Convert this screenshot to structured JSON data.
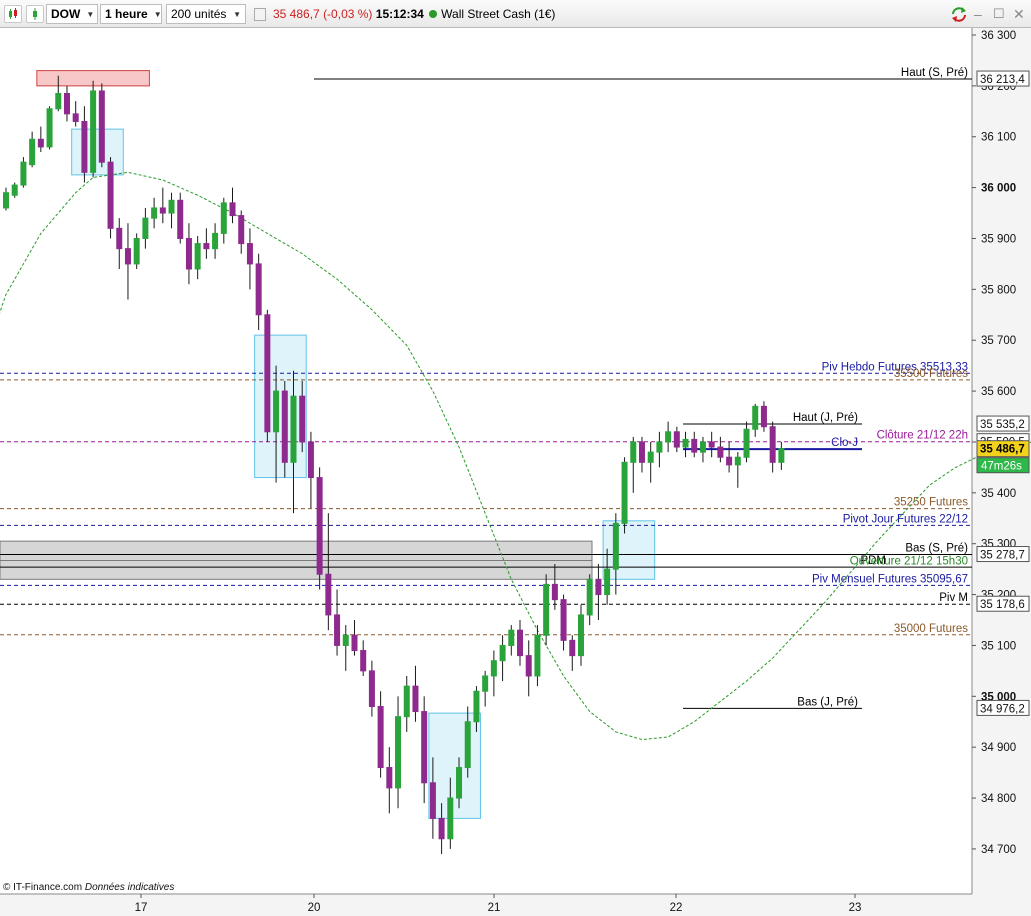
{
  "toolbar": {
    "symbol": "DOW",
    "timeframe": "1 heure",
    "units": "200 unités",
    "price": "35 486,7",
    "change": "(-0,03 %)",
    "time": "15:12:34",
    "instrument": "Wall Street Cash (1€)"
  },
  "colors": {
    "up": "#2aa43a",
    "down": "#8e2a8e",
    "sma": "#2a9a2a",
    "pivot_hebdo": "#1a1aa0",
    "pivot_mensuel": "#1a1aa0",
    "futures": "#8a5a2a",
    "cloture": "#9a1a9a"
  },
  "footer": {
    "source": "© IT-Finance.com",
    "note": "Données indicatives"
  },
  "chart_data": {
    "type": "candlestick",
    "yaxis": {
      "ticks": [
        "36 300",
        "36 200",
        "36 100",
        "36 000",
        "35 900",
        "35 800",
        "35 700",
        "35 600",
        "35 500",
        "35 400",
        "35 300",
        "35 200",
        "35 100",
        "35 000",
        "34 900",
        "34 800",
        "34 700"
      ],
      "tick_values": [
        36300,
        36200,
        36100,
        36000,
        35900,
        35800,
        35700,
        35600,
        35500,
        35400,
        35300,
        35200,
        35100,
        35000,
        34900,
        34800,
        34700
      ],
      "bold_ticks": [
        "36 000",
        "35 000"
      ],
      "range": [
        34630,
        36325
      ]
    },
    "xaxis": {
      "labels": [
        "17",
        "20",
        "21",
        "22",
        "23"
      ]
    },
    "current_price": {
      "label": "35 486,7",
      "value": 35486.7,
      "countdown": "47m26s"
    },
    "levels": [
      {
        "label": "Haut (S, Pré)",
        "value": 36213.4,
        "tag": "36 213,4",
        "style": "solid",
        "color": "#000000",
        "start": "mid"
      },
      {
        "label": "Piv Hebdo Futures 35513,33",
        "value": 35635,
        "tag": "",
        "style": "dashed",
        "color": "#1a1aa0",
        "start": "all"
      },
      {
        "label": "35500 Futures",
        "value": 35622,
        "tag": "",
        "style": "dashed",
        "color": "#8a5a2a",
        "start": "all"
      },
      {
        "label": "Haut (J, Pré)",
        "value": 35535.2,
        "tag": "35 535,2",
        "style": "solid",
        "color": "#000000",
        "start": "late"
      },
      {
        "label": "Clôture 21/12 22h",
        "value": 35500.5,
        "tag": "35 500,5",
        "style": "dashed",
        "color": "#9a1a9a",
        "start": "all"
      },
      {
        "label": "Clo-J",
        "value": 35486,
        "tag": "",
        "style": "solid",
        "color": "#1a1aa0",
        "start": "late"
      },
      {
        "label": "35250 Futures",
        "value": 35369,
        "tag": "",
        "style": "dashed",
        "color": "#8a5a2a",
        "start": "all"
      },
      {
        "label": "Pivot Jour Futures 22/12",
        "value": 35336,
        "tag": "",
        "style": "dashed",
        "color": "#1a1aa0",
        "start": "all"
      },
      {
        "label": "Bas (S, Pré)",
        "value": 35278.7,
        "tag": "35 278,7",
        "style": "solid",
        "color": "#000000",
        "start": "all"
      },
      {
        "label": "PDM",
        "value": 35254,
        "tag": "",
        "style": "solid",
        "color": "#000000",
        "start": "all"
      },
      {
        "label": "Ouverture 21/12 15h30",
        "value": 35253,
        "tag": "",
        "style": "solid",
        "color": "#2a8a2a",
        "start": "none"
      },
      {
        "label": "Piv Mensuel Futures 35095,67",
        "value": 35218,
        "tag": "",
        "style": "dashed",
        "color": "#1a1aa0",
        "start": "all"
      },
      {
        "label": "Piv M",
        "value": 35181,
        "tag": "35 178,6",
        "style": "dashed",
        "color": "#000000",
        "start": "all"
      },
      {
        "label": "35000 Futures",
        "value": 35121,
        "tag": "",
        "style": "dashed",
        "color": "#8a5a2a",
        "start": "all"
      },
      {
        "label": "Bas (J, Pré)",
        "value": 34976.2,
        "tag": "34 976,2",
        "style": "solid",
        "color": "#000000",
        "start": "late"
      }
    ],
    "sma": [
      [
        -1,
        35740
      ],
      [
        0,
        35790
      ],
      [
        4,
        35910
      ],
      [
        8,
        35990
      ],
      [
        10,
        36020
      ],
      [
        14,
        36030
      ],
      [
        18,
        36015
      ],
      [
        22,
        35985
      ],
      [
        26,
        35950
      ],
      [
        30,
        35910
      ],
      [
        34,
        35870
      ],
      [
        38,
        35820
      ],
      [
        42,
        35760
      ],
      [
        46,
        35690
      ],
      [
        49,
        35600
      ],
      [
        52,
        35490
      ],
      [
        55,
        35360
      ],
      [
        58,
        35230
      ],
      [
        61,
        35130
      ],
      [
        64,
        35040
      ],
      [
        67,
        34970
      ],
      [
        70,
        34930
      ],
      [
        73,
        34915
      ],
      [
        76,
        34920
      ],
      [
        79,
        34950
      ],
      [
        82,
        34990
      ],
      [
        85,
        35030
      ],
      [
        88,
        35075
      ],
      [
        91,
        35130
      ],
      [
        94,
        35185
      ],
      [
        97,
        35245
      ],
      [
        100,
        35305
      ],
      [
        103,
        35360
      ],
      [
        106,
        35415
      ],
      [
        109,
        35450
      ],
      [
        112,
        35475
      ],
      [
        114,
        35490
      ],
      [
        116,
        35496
      ],
      [
        118,
        35500
      ],
      [
        120,
        35504
      ],
      [
        122,
        35507
      ],
      [
        125,
        35509
      ]
    ],
    "candles": [
      [
        35960,
        36000,
        35955,
        35990
      ],
      [
        35985,
        36010,
        35980,
        36005
      ],
      [
        36005,
        36060,
        36000,
        36050
      ],
      [
        36045,
        36110,
        36040,
        36095
      ],
      [
        36095,
        36120,
        36070,
        36080
      ],
      [
        36080,
        36160,
        36075,
        36155
      ],
      [
        36155,
        36220,
        36150,
        36185
      ],
      [
        36185,
        36200,
        36130,
        36145
      ],
      [
        36145,
        36170,
        36120,
        36130
      ],
      [
        36130,
        36160,
        36010,
        36030
      ],
      [
        36030,
        36210,
        36020,
        36190
      ],
      [
        36190,
        36205,
        36040,
        36050
      ],
      [
        36050,
        36060,
        35900,
        35920
      ],
      [
        35920,
        35940,
        35840,
        35880
      ],
      [
        35880,
        35930,
        35780,
        35850
      ],
      [
        35850,
        35910,
        35840,
        35900
      ],
      [
        35900,
        35960,
        35880,
        35940
      ],
      [
        35940,
        35980,
        35920,
        35960
      ],
      [
        35960,
        36000,
        35930,
        35950
      ],
      [
        35950,
        35990,
        35920,
        35975
      ],
      [
        35975,
        35990,
        35890,
        35900
      ],
      [
        35900,
        35930,
        35810,
        35840
      ],
      [
        35840,
        35905,
        35820,
        35890
      ],
      [
        35890,
        35920,
        35860,
        35880
      ],
      [
        35880,
        35930,
        35860,
        35910
      ],
      [
        35910,
        35980,
        35890,
        35970
      ],
      [
        35970,
        36000,
        35930,
        35945
      ],
      [
        35945,
        35955,
        35870,
        35890
      ],
      [
        35890,
        35920,
        35800,
        35850
      ],
      [
        35850,
        35870,
        35720,
        35750
      ],
      [
        35750,
        35760,
        35500,
        35520
      ],
      [
        35520,
        35650,
        35420,
        35600
      ],
      [
        35600,
        35620,
        35430,
        35460
      ],
      [
        35460,
        35640,
        35360,
        35590
      ],
      [
        35590,
        35620,
        35480,
        35500
      ],
      [
        35500,
        35520,
        35370,
        35430
      ],
      [
        35430,
        35450,
        35210,
        35240
      ],
      [
        35240,
        35360,
        35130,
        35160
      ],
      [
        35160,
        35210,
        35080,
        35100
      ],
      [
        35100,
        35140,
        35050,
        35120
      ],
      [
        35120,
        35150,
        35080,
        35090
      ],
      [
        35090,
        35110,
        35040,
        35050
      ],
      [
        35050,
        35070,
        34960,
        34980
      ],
      [
        34980,
        35010,
        34840,
        34860
      ],
      [
        34860,
        34900,
        34770,
        34820
      ],
      [
        34820,
        35000,
        34780,
        34960
      ],
      [
        34960,
        35040,
        34930,
        35020
      ],
      [
        35020,
        35060,
        34950,
        34970
      ],
      [
        34970,
        35000,
        34790,
        34830
      ],
      [
        34830,
        34880,
        34720,
        34760
      ],
      [
        34760,
        34790,
        34690,
        34720
      ],
      [
        34720,
        34840,
        34700,
        34800
      ],
      [
        34800,
        34880,
        34780,
        34860
      ],
      [
        34860,
        34980,
        34840,
        34950
      ],
      [
        34950,
        35020,
        34930,
        35010
      ],
      [
        35010,
        35050,
        34980,
        35040
      ],
      [
        35040,
        35090,
        35000,
        35070
      ],
      [
        35070,
        35120,
        35030,
        35100
      ],
      [
        35100,
        35140,
        35080,
        35130
      ],
      [
        35130,
        35150,
        35060,
        35080
      ],
      [
        35080,
        35110,
        35000,
        35040
      ],
      [
        35040,
        35140,
        35020,
        35120
      ],
      [
        35120,
        35240,
        35100,
        35220
      ],
      [
        35220,
        35260,
        35170,
        35190
      ],
      [
        35190,
        35200,
        35090,
        35110
      ],
      [
        35110,
        35120,
        35050,
        35080
      ],
      [
        35080,
        35180,
        35060,
        35160
      ],
      [
        35160,
        35240,
        35140,
        35230
      ],
      [
        35230,
        35260,
        35150,
        35200
      ],
      [
        35200,
        35290,
        35180,
        35250
      ],
      [
        35250,
        35360,
        35200,
        35340
      ],
      [
        35340,
        35470,
        35320,
        35460
      ],
      [
        35460,
        35510,
        35400,
        35500
      ],
      [
        35500,
        35510,
        35440,
        35460
      ],
      [
        35460,
        35500,
        35420,
        35480
      ],
      [
        35480,
        35520,
        35450,
        35500
      ],
      [
        35500,
        35540,
        35480,
        35520
      ],
      [
        35520,
        35530,
        35480,
        35490
      ],
      [
        35490,
        35520,
        35470,
        35505
      ],
      [
        35505,
        35520,
        35470,
        35480
      ],
      [
        35480,
        35510,
        35460,
        35500
      ],
      [
        35500,
        35520,
        35470,
        35490
      ],
      [
        35490,
        35510,
        35460,
        35470
      ],
      [
        35470,
        35500,
        35440,
        35455
      ],
      [
        35455,
        35480,
        35410,
        35470
      ],
      [
        35470,
        35540,
        35460,
        35525
      ],
      [
        35525,
        35575,
        35510,
        35570
      ],
      [
        35570,
        35580,
        35520,
        35530
      ],
      [
        35530,
        35540,
        35440,
        35460
      ],
      [
        35460,
        35500,
        35445,
        35487
      ]
    ]
  }
}
